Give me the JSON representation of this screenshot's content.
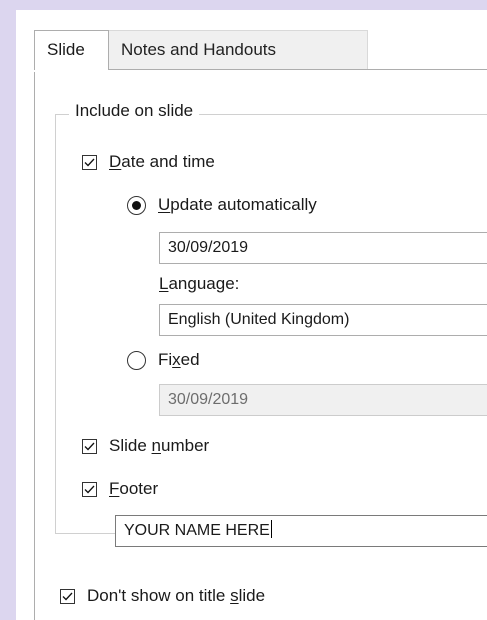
{
  "tabs": [
    {
      "label": "Slide"
    },
    {
      "label": "Notes and Handouts"
    }
  ],
  "include_group": {
    "label": "Include on slide"
  },
  "date_time": {
    "label": "Date and time",
    "label_underline_char": "D",
    "checked": true,
    "update_auto": {
      "label": "Update automatically",
      "selected": true,
      "value": "30/09/2019"
    },
    "language": {
      "label": "Language:",
      "value": "English (United Kingdom)"
    },
    "fixed": {
      "label": "Fixed",
      "selected": false,
      "value": "30/09/2019"
    }
  },
  "slide_number": {
    "label": "Slide number",
    "checked": true
  },
  "footer": {
    "label": "Footer",
    "checked": true,
    "value": "YOUR NAME HERE"
  },
  "dont_show_title": {
    "label": "Don't show on title slide",
    "checked": true
  },
  "labels": {
    "date_and_time_rest": "ate and time",
    "update_u": "U",
    "update_rest": "pdate automatically",
    "language_l": "L",
    "language_rest": "anguage:",
    "fixed_fi": "Fi",
    "fixed_x": "x",
    "fixed_ed": "ed",
    "slide_num_pre": "Slide ",
    "slide_num_n": "n",
    "slide_num_post": "umber",
    "footer_f": "F",
    "footer_rest": "ooter",
    "dont_pre": "Don't show on title ",
    "dont_s": "s",
    "dont_post": "lide"
  }
}
